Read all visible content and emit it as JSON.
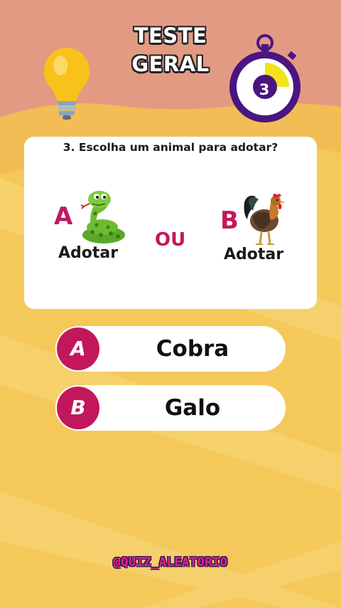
{
  "header": {
    "title_line1": "TESTE",
    "title_line2": "GERAL",
    "timer_value": "3",
    "timer_progress": 0.25
  },
  "question": {
    "text": "3. Escolha um animal para adotar?",
    "separator": "OU",
    "option_a": {
      "letter": "A",
      "label": "Adotar",
      "icon": "snake-icon"
    },
    "option_b": {
      "letter": "B",
      "label": "Adotar",
      "icon": "rooster-icon"
    }
  },
  "answers": [
    {
      "letter": "A",
      "text": "Cobra"
    },
    {
      "letter": "B",
      "text": "Galo"
    }
  ],
  "footer": {
    "handle": "@QUIZ_ALEATORIO"
  },
  "colors": {
    "background": "#f4c95a",
    "sky": "#e39a83",
    "accent": "#c2185b",
    "timer_ring": "#4a1580",
    "timer_fill": "#f2e31b"
  }
}
